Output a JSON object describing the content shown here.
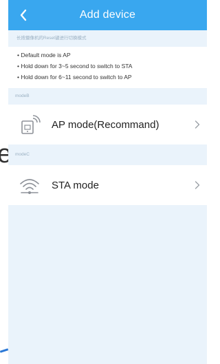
{
  "header": {
    "title": "Add device",
    "back_icon": "chevron-left-icon",
    "background": "#39a7ef"
  },
  "hint": "长按摄像机的Reset键进行切换模式",
  "info": {
    "lines": [
      "• Default mode is AP",
      "• Hold down for 3~5 second to switch to STA",
      "• Hold down for 6~11 second to switch to AP"
    ]
  },
  "sections": [
    {
      "label": "modeB",
      "mode_label": "AP mode(Recommand)",
      "icon": "router-icon"
    },
    {
      "label": "modeC",
      "mode_label": "STA mode",
      "icon": "wifi-icon"
    }
  ],
  "background_fragment": "e",
  "colors": {
    "accent": "#39a7ef",
    "page_bg": "#eaf3fb",
    "hint_text": "#9ab0c2"
  }
}
